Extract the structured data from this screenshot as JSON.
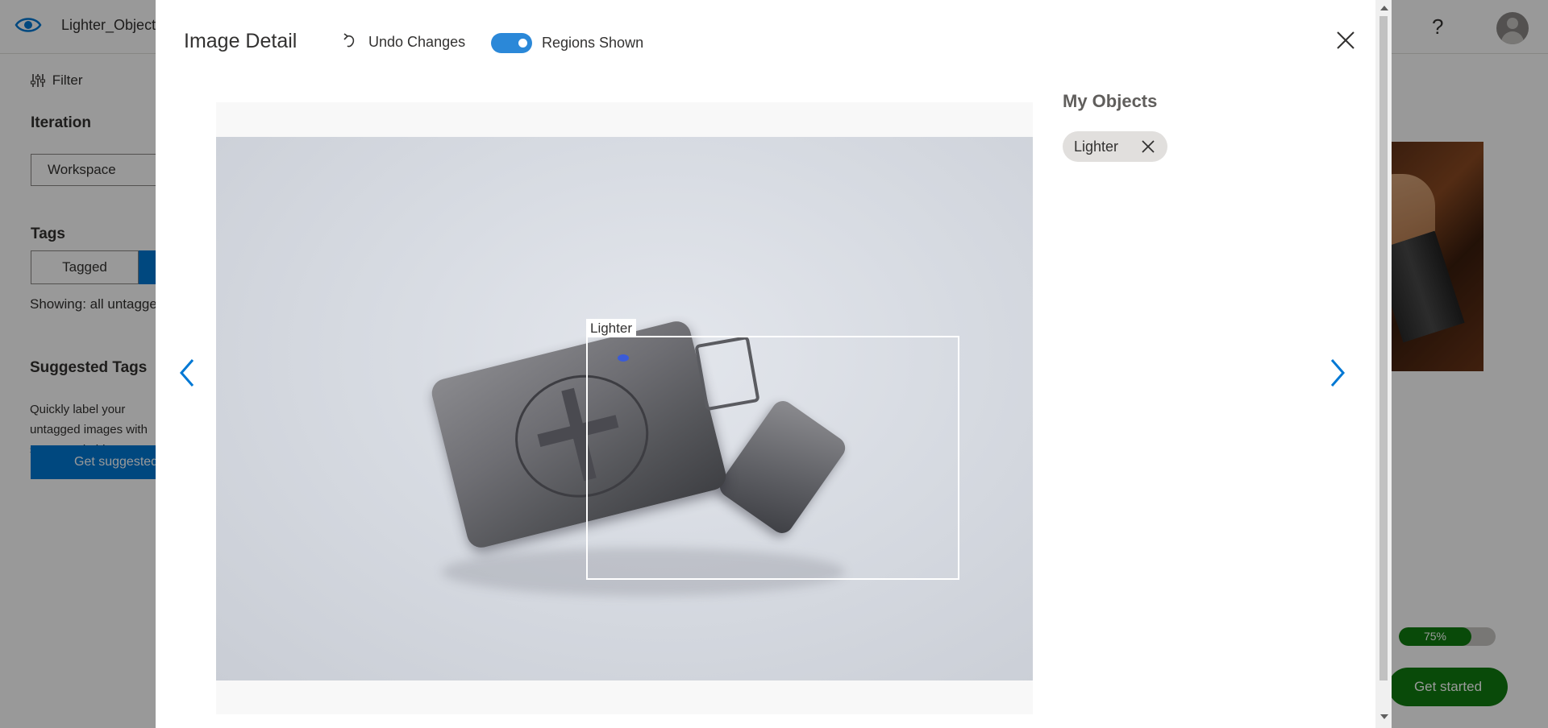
{
  "app": {
    "project_name": "Lighter_Object",
    "filter_label": "Filter",
    "iteration_label": "Iteration",
    "iteration_value": "Workspace",
    "tags_label": "Tags",
    "tagged_label": "Tagged",
    "showing_text": "Showing: all untagged",
    "suggested_title": "Suggested Tags",
    "suggested_desc": "Quickly label your untagged images with suggested objects",
    "suggest_button": "Get suggested",
    "help_icon": "?",
    "progress": {
      "value": 0.75,
      "text": "75%"
    },
    "get_started": "Get started"
  },
  "modal": {
    "title": "Image Detail",
    "undo_label": "Undo Changes",
    "regions_toggle": {
      "on": true,
      "label": "Regions Shown"
    },
    "region": {
      "label": "Lighter"
    },
    "objects_title": "My Objects",
    "objects": [
      {
        "label": "Lighter"
      }
    ]
  },
  "colors": {
    "accent": "#0078d4",
    "toggle_on": "#2b88d8",
    "success": "#107c10"
  },
  "icons": {
    "logo": "eye-icon",
    "close": "close-icon",
    "undo": "undo-icon",
    "prev": "chevron-left-icon",
    "next": "chevron-right-icon",
    "chip_remove": "close-icon",
    "filter": "filter-icon",
    "help": "help-icon",
    "avatar": "avatar-icon"
  }
}
